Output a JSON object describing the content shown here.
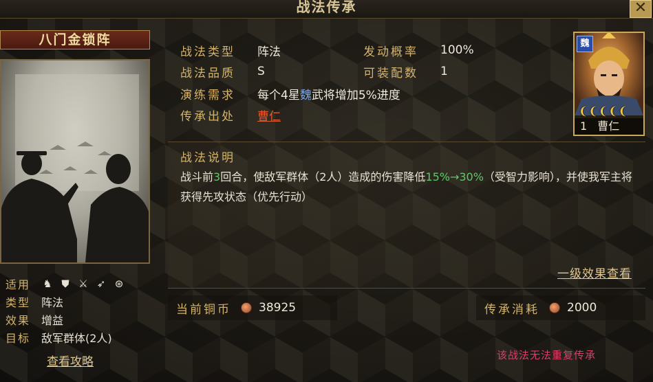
{
  "window": {
    "title": "战法传承",
    "close_label": "✕"
  },
  "skill": {
    "name": "八门金锁阵",
    "left_info": {
      "apply_label": "适用",
      "apply_icons": [
        "cavalry-icon",
        "shield-icon",
        "crossed-swords-icon",
        "bow-icon",
        "chariot-wheel-icon"
      ],
      "type_label": "类型",
      "type_value": "阵法",
      "effect_label": "效果",
      "effect_value": "增益",
      "target_label": "目标",
      "target_value": "敌军群体(2人)"
    },
    "guide_link": "查看攻略"
  },
  "details": {
    "type_label": "战法类型",
    "type_value": "阵法",
    "quality_label": "战法品质",
    "quality_value": "S",
    "trigger_label": "发动概率",
    "trigger_value": "100%",
    "equip_label": "可装配数",
    "equip_value": "1",
    "drill_label": "演练需求",
    "drill_value_prefix": "每个4星",
    "drill_value_faction": "魏",
    "drill_value_suffix": "武将增加5%进度",
    "origin_label": "传承出处",
    "origin_value": "曹仁"
  },
  "general": {
    "faction_badge": "魏",
    "stars": "❨❨❨❨❨",
    "level": "1",
    "name": "曹仁"
  },
  "description": {
    "title": "战法说明",
    "text_1": "战斗前",
    "text_2": "3",
    "text_3": "回合，使敌军群体（2人）造成的伤害降低",
    "text_4": "15%→30%",
    "text_5": "（受智力影响），并使我军主将获得先攻状态（优先行动）",
    "effect_link": "一级效果查看"
  },
  "currency": {
    "current_label": "当前铜币",
    "current_value": "38925",
    "cost_label": "传承消耗",
    "cost_value": "2000"
  },
  "warning": "该战法无法重复传承",
  "colors": {
    "accent_gold": "#d4b46a",
    "warning_pink": "#d8406a",
    "highlight_green": "#5ec86a",
    "faction_blue": "#7aa8e8",
    "origin_red": "#e05a30"
  }
}
